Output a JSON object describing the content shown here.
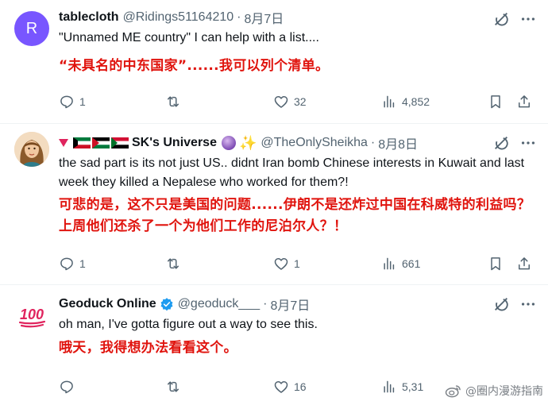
{
  "tweets": [
    {
      "name": "tablecloth",
      "handle": "@Ridings51164210",
      "separator": "·",
      "date": "8月7日",
      "avatar_letter": "R",
      "avatar_color": "#7856ff",
      "text": "\"Unnamed ME country\" I can help with a list....",
      "translation": "“未具名的中东国家”......我可以列个清单。",
      "replies": "1",
      "retweets": "",
      "likes": "32",
      "views": "4,852"
    },
    {
      "name": "SK's Universe",
      "handle": "@TheOnlySheikha",
      "separator": "·",
      "date": "8月8日",
      "text": "the sad part is its not just US.. didnt Iran bomb Chinese interests in Kuwait and last week they killed a Nepalese who worked for them?!",
      "translation": "可悲的是，这不只是美国的问题......伊朗不是还炸过中国在科威特的利益吗？上周他们还杀了一个为他们工作的尼泊尔人？！",
      "replies": "1",
      "retweets": "",
      "likes": "1",
      "views": "661"
    },
    {
      "name": "Geoduck Online",
      "handle": "@geoduck___",
      "separator": "·",
      "date": "8月7日",
      "text": "oh man, I've gotta figure out a way to see this.",
      "translation": "哦天，我得想办法看看这个。",
      "replies": "",
      "retweets": "",
      "likes": "16",
      "views": "5,31"
    }
  ],
  "watermark": {
    "text": "@圈内漫游指南"
  },
  "colors": {
    "translation_red": "#e0140e",
    "muted": "#536471",
    "verified_blue": "#1d9bf0"
  }
}
